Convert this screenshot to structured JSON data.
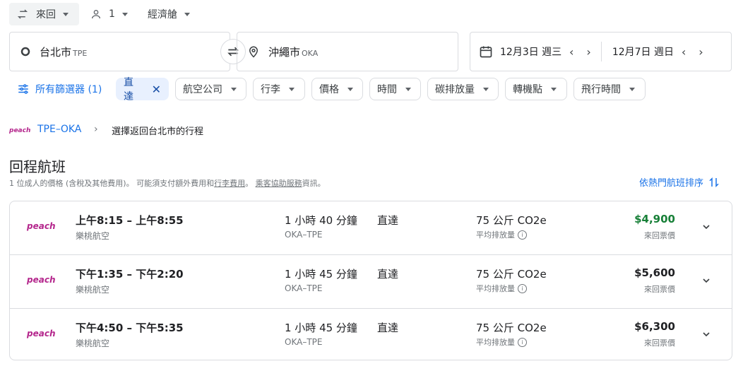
{
  "topbar": {
    "trip_type": "來回",
    "passengers": "1",
    "cabin": "經濟艙"
  },
  "search": {
    "origin": "台北市",
    "origin_code": "TPE",
    "destination": "沖繩市",
    "destination_code": "OKA",
    "depart_date": "12月3日 週三",
    "return_date": "12月7日 週日"
  },
  "filters": {
    "all_filters": "所有篩選器 (1)",
    "chips": [
      "直達",
      "航空公司",
      "行李",
      "價格",
      "時間",
      "碳排放量",
      "轉機點",
      "飛行時間"
    ]
  },
  "breadcrumb": {
    "airline_logo": "peach",
    "route": "TPE–OKA",
    "current": "選擇返回台北市的行程"
  },
  "section": {
    "title": "回程航班",
    "note_prefix": "1 位成人的價格 (含稅及其他費用)。 可能須支付額外費用和",
    "link_baggage": "行李費用",
    "note_sep": "。",
    "link_assist": "乘客協助服務",
    "note_suffix": "資訊。",
    "sort_label": "依熱門航班排序"
  },
  "flights": [
    {
      "logo": "peach",
      "time": "上午8:15 – 上午8:55",
      "airline": "樂桃航空",
      "duration": "1 小時 40 分鐘",
      "route": "OKA–TPE",
      "stops": "直達",
      "co2": "75 公斤 CO2e",
      "co2_note": "平均排放量",
      "price": "$4,900",
      "price_type": "來回票價",
      "price_color": "#188038"
    },
    {
      "logo": "peach",
      "time": "下午1:35 – 下午2:20",
      "airline": "樂桃航空",
      "duration": "1 小時 45 分鐘",
      "route": "OKA–TPE",
      "stops": "直達",
      "co2": "75 公斤 CO2e",
      "co2_note": "平均排放量",
      "price": "$5,600",
      "price_type": "來回票價",
      "price_color": "#202124"
    },
    {
      "logo": "peach",
      "time": "下午4:50 – 下午5:35",
      "airline": "樂桃航空",
      "duration": "1 小時 45 分鐘",
      "route": "OKA–TPE",
      "stops": "直達",
      "co2": "75 公斤 CO2e",
      "co2_note": "平均排放量",
      "price": "$6,300",
      "price_type": "來回票價",
      "price_color": "#202124"
    }
  ],
  "colors": {
    "accent": "#1a73e8",
    "peach": "#b4268c",
    "best_price": "#188038"
  }
}
